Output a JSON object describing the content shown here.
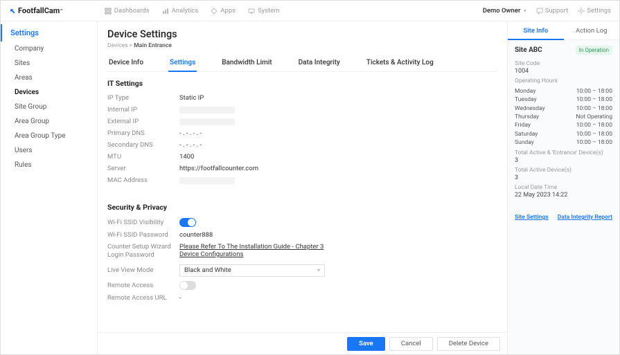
{
  "brand": "FootfallCam",
  "brand_tm": "™",
  "topnav": {
    "items": [
      {
        "label": "Dashboards"
      },
      {
        "label": "Analytics"
      },
      {
        "label": "Apps"
      },
      {
        "label": "System"
      }
    ],
    "owner": "Demo Owner",
    "support": "Support",
    "settings": "Settings"
  },
  "sidebar": {
    "title": "Settings",
    "items": [
      {
        "label": "Company"
      },
      {
        "label": "Sites"
      },
      {
        "label": "Areas"
      },
      {
        "label": "Devices",
        "active": true
      },
      {
        "label": "Site Group"
      },
      {
        "label": "Area Group"
      },
      {
        "label": "Area Group Type"
      },
      {
        "label": "Users"
      },
      {
        "label": "Rules"
      }
    ]
  },
  "page": {
    "title": "Device Settings",
    "breadcrumb_root": "Devices",
    "breadcrumb_sep": ">",
    "breadcrumb_current": "Main Entrance"
  },
  "tabs": [
    {
      "label": "Device Info"
    },
    {
      "label": "Settings",
      "active": true
    },
    {
      "label": "Bandwidth Limit"
    },
    {
      "label": "Data Integrity"
    },
    {
      "label": "Tickets & Activity Log"
    }
  ],
  "sections": {
    "it": {
      "title": "IT Settings",
      "ip_type_label": "IP Type",
      "ip_type_value": "Static IP",
      "internal_ip_label": "Internal IP",
      "external_ip_label": "External IP",
      "primary_dns_label": "Primary DNS",
      "primary_dns_value": "- . - . - . -",
      "secondary_dns_label": "Secondary DNS",
      "secondary_dns_value": "- . - . - . -",
      "mtu_label": "MTU",
      "mtu_value": "1400",
      "server_label": "Server",
      "server_value": "https://footfallcounter.com",
      "mac_label": "MAC Address"
    },
    "security": {
      "title": "Security & Privacy",
      "wifi_vis_label": "Wi-Fi SSID Visibility",
      "wifi_pass_label": "Wi-Fi SSID Password",
      "wifi_pass_value": "counter888",
      "wizard_label": "Counter Setup Wizard Login Password",
      "wizard_value": "Please Refer To The Installation Guide - Chapter 3 Device Configurations",
      "live_view_label": "Live View Mode",
      "live_view_value": "Black and White",
      "remote_access_label": "Remote Access",
      "remote_url_label": "Remote Access URL",
      "remote_url_value": "-"
    }
  },
  "right": {
    "tabs": [
      {
        "label": "Site Info",
        "active": true
      },
      {
        "label": "Action Log"
      }
    ],
    "site_name": "Site ABC",
    "status": "In Operation",
    "site_code_label": "Site Code",
    "site_code_value": "1004",
    "hours_label": "Operating Hours",
    "hours": [
      {
        "d": "Monday",
        "t": "10:00 – 18:00"
      },
      {
        "d": "Tuesday",
        "t": "10:00 – 18:00"
      },
      {
        "d": "Wednesday",
        "t": "10:00 – 18:00"
      },
      {
        "d": "Thursday",
        "t": "Not Operating"
      },
      {
        "d": "Friday",
        "t": "10:00 – 18:00"
      },
      {
        "d": "Saturday",
        "t": "10:00 – 18:00"
      },
      {
        "d": "Sunday",
        "t": "10:00 – 18:00"
      }
    ],
    "total_entrance_label": "Total Active  & 'Entrance' Device(s)",
    "total_entrance_value": "3",
    "total_active_label": "Total Active Device(s)",
    "total_active_value": "3",
    "local_time_label": "Local Date Time",
    "local_time_value": "22 May 2023  14:22",
    "site_settings_link": "Site Settings",
    "integrity_link": "Data Integrity Report"
  },
  "footer": {
    "save": "Save",
    "cancel": "Cancel",
    "delete": "Delete Device"
  }
}
